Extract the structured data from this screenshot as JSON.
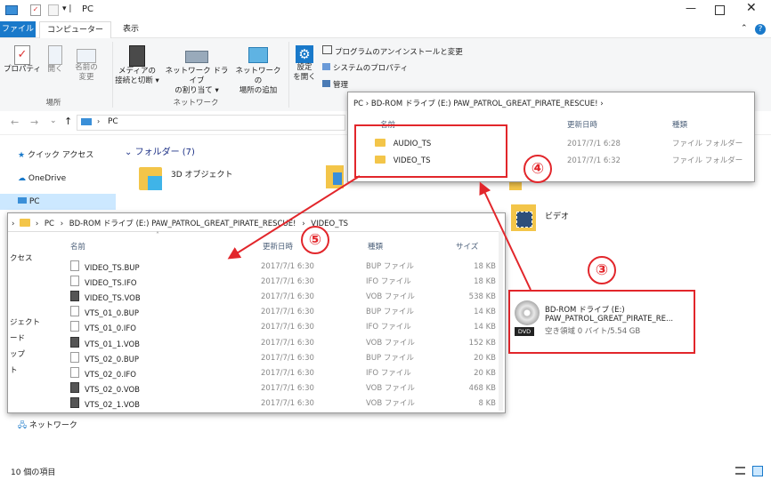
{
  "window": {
    "title": "PC"
  },
  "ribbon_tabs": [
    "ファイル",
    "コンピューター",
    "表示"
  ],
  "ribbon": {
    "location_group": "場所",
    "network_group": "ネットワーク",
    "properties": "プロパティ",
    "open": "開く",
    "rename_1": "名前の",
    "rename_2": "変更",
    "media_1": "メディアの",
    "media_2": "接続と切断 ▾",
    "map_drive_1": "ネットワーク ドライブ",
    "map_drive_2": "の割り当て ▾",
    "add_location_1": "ネットワークの",
    "add_location_2": "場所の追加",
    "settings_1": "設定",
    "settings_2": "を開く",
    "uninstall": "プログラムのアンインストールと変更",
    "system_props": "システムのプロパティ",
    "manage": "管理"
  },
  "address": {
    "crumb": "PC"
  },
  "nav": {
    "quick_access": "クイック アクセス",
    "onedrive": "OneDrive",
    "pc": "PC",
    "network": "ネットワーク",
    "partial": [
      "クセス",
      "ジェクト",
      "ード",
      "ップ",
      "ト"
    ]
  },
  "main": {
    "folders_header": "フォルダー (7)",
    "objects3d": "3D オブジェクト",
    "video": "ビデオ"
  },
  "drive": {
    "name_1": "BD-ROM ドライブ (E:)",
    "name_2": "PAW_PATROL_GREAT_PIRATE_RE...",
    "space": "空き領域 0 バイト/5.54 GB",
    "badge": "DVD"
  },
  "status": {
    "count": "10 個の項目"
  },
  "win_root": {
    "breadcrumb": "PC  ›  BD-ROM ドライブ (E:) PAW_PATROL_GREAT_PIRATE_RESCUE!  ›",
    "col_name": "名前",
    "col_date": "更新日時",
    "col_type": "種類",
    "rows": [
      {
        "name": "AUDIO_TS",
        "date": "2017/7/1 6:28",
        "type": "ファイル フォルダー"
      },
      {
        "name": "VIDEO_TS",
        "date": "2017/7/1 6:32",
        "type": "ファイル フォルダー"
      }
    ]
  },
  "win_video": {
    "crumb_pc": "PC",
    "crumb_drive": "BD-ROM ドライブ (E:) PAW_PATROL_GREAT_PIRATE_RESCUE!",
    "crumb_folder": "VIDEO_TS",
    "col_name": "名前",
    "col_date": "更新日時",
    "col_type": "種類",
    "col_size": "サイズ",
    "rows": [
      {
        "name": "VIDEO_TS.BUP",
        "date": "2017/7/1 6:30",
        "type": "BUP ファイル",
        "size": "18 KB",
        "kind": "file"
      },
      {
        "name": "VIDEO_TS.IFO",
        "date": "2017/7/1 6:30",
        "type": "IFO ファイル",
        "size": "18 KB",
        "kind": "file"
      },
      {
        "name": "VIDEO_TS.VOB",
        "date": "2017/7/1 6:30",
        "type": "VOB ファイル",
        "size": "538 KB",
        "kind": "vob"
      },
      {
        "name": "VTS_01_0.BUP",
        "date": "2017/7/1 6:30",
        "type": "BUP ファイル",
        "size": "14 KB",
        "kind": "file"
      },
      {
        "name": "VTS_01_0.IFO",
        "date": "2017/7/1 6:30",
        "type": "IFO ファイル",
        "size": "14 KB",
        "kind": "file"
      },
      {
        "name": "VTS_01_1.VOB",
        "date": "2017/7/1 6:30",
        "type": "VOB ファイル",
        "size": "152 KB",
        "kind": "vob"
      },
      {
        "name": "VTS_02_0.BUP",
        "date": "2017/7/1 6:30",
        "type": "BUP ファイル",
        "size": "20 KB",
        "kind": "file"
      },
      {
        "name": "VTS_02_0.IFO",
        "date": "2017/7/1 6:30",
        "type": "IFO ファイル",
        "size": "20 KB",
        "kind": "file"
      },
      {
        "name": "VTS_02_0.VOB",
        "date": "2017/7/1 6:30",
        "type": "VOB ファイル",
        "size": "468 KB",
        "kind": "vob"
      },
      {
        "name": "VTS_02_1.VOB",
        "date": "2017/7/1 6:30",
        "type": "VOB ファイル",
        "size": "8 KB",
        "kind": "vob"
      }
    ]
  },
  "annotations": {
    "n3": "③",
    "n4": "④",
    "n5": "⑤"
  },
  "colors": {
    "accent": "#1979ca",
    "highlight": "#e2262b"
  }
}
